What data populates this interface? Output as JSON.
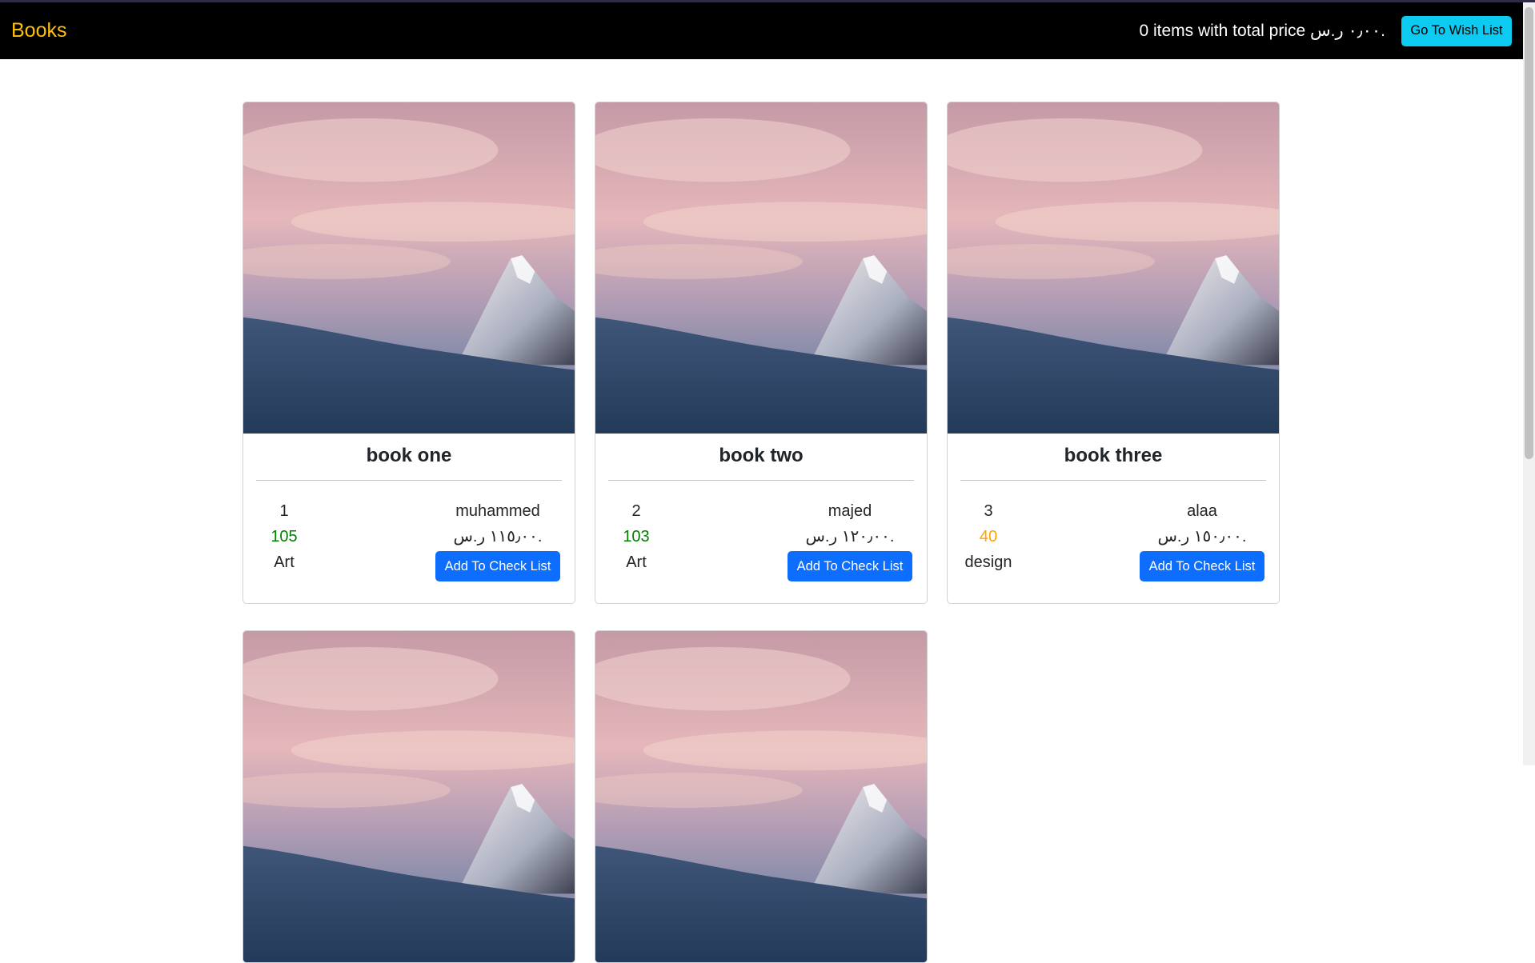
{
  "navbar": {
    "brand": "Books",
    "summary_prefix": "0 items with total price ",
    "summary_price": "٠٫٠٠ ر.س.",
    "wish_button": "Go To Wish List"
  },
  "colors": {
    "navbar_bg": "#000000",
    "brand": "#ffc107",
    "wish_button": "#0dcaf0",
    "primary_button": "#0d6efd",
    "count_high": "#008000",
    "count_low": "#ffa500"
  },
  "books": [
    {
      "title": "book one",
      "id": "1",
      "author": "muhammed",
      "count": "105",
      "count_color": "#008000",
      "price": "١١٥٫٠٠ ر.س.",
      "category": "Art",
      "button": "Add To Check List",
      "image": "mountain-photo"
    },
    {
      "title": "book two",
      "id": "2",
      "author": "majed",
      "count": "103",
      "count_color": "#008000",
      "price": "١٢٠٫٠٠ ر.س.",
      "category": "Art",
      "button": "Add To Check List",
      "image": "mountain-photo"
    },
    {
      "title": "book three",
      "id": "3",
      "author": "alaa",
      "count": "40",
      "count_color": "#ffa500",
      "price": "١٥٠٫٠٠ ر.س.",
      "category": "design",
      "button": "Add To Check List",
      "image": "mountain-photo"
    },
    {
      "image": "mountain-photo"
    },
    {
      "image": "mountain-photo"
    }
  ]
}
